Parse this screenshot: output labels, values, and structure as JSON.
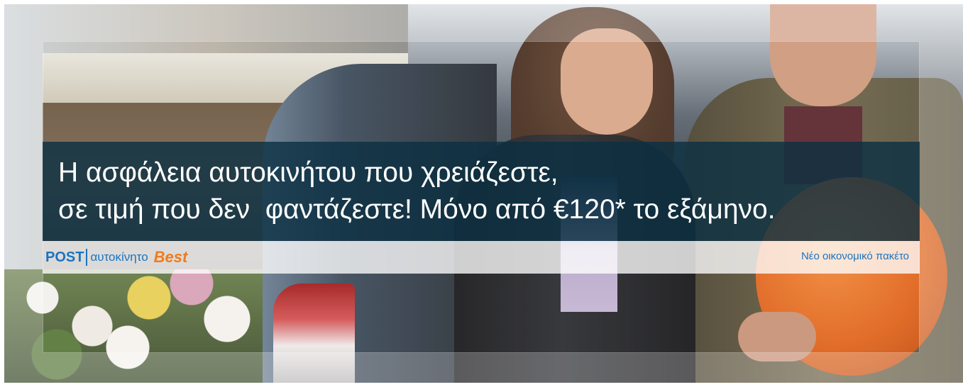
{
  "banner": {
    "headline_line1": "Η ασφάλεια αυτοκινήτου που χρειάζεστε,",
    "headline_line2": "σε τιμή που δεν  φαντάζεστε! Μόνο από €120* το εξάμηνο.",
    "brand_post": "POST",
    "brand_product": "αυτοκίνητο",
    "brand_best": "Best",
    "package_label": "Νέο οικονομικό πακέτο"
  },
  "colors": {
    "headline_band": "#0a3042",
    "brand_blue": "#1a74c1",
    "brand_orange": "#f07b1f"
  }
}
